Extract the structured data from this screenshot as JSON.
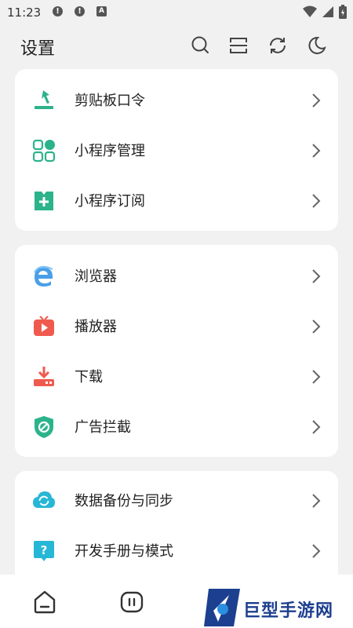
{
  "status_bar": {
    "time": "11:23",
    "alert1": "!",
    "alert2": "!",
    "alert3": "A"
  },
  "header": {
    "title": "设置"
  },
  "sections": [
    {
      "items": [
        {
          "label": "剪贴板口令",
          "icon": "clipboard-download-icon"
        },
        {
          "label": "小程序管理",
          "icon": "grid-apps-icon"
        },
        {
          "label": "小程序订阅",
          "icon": "bookmark-plus-icon"
        }
      ]
    },
    {
      "items": [
        {
          "label": "浏览器",
          "icon": "browser-e-icon"
        },
        {
          "label": "播放器",
          "icon": "tv-play-icon"
        },
        {
          "label": "下载",
          "icon": "download-icon"
        },
        {
          "label": "广告拦截",
          "icon": "shield-block-icon"
        }
      ]
    },
    {
      "items": [
        {
          "label": "数据备份与同步",
          "icon": "cloud-sync-icon"
        },
        {
          "label": "开发手册与模式",
          "icon": "help-bubble-icon"
        }
      ]
    }
  ],
  "colors": {
    "accent_green": "#2bb38b",
    "blue": "#3ea3e6",
    "red": "#f05a4e",
    "cyan": "#27b7d6"
  },
  "watermark": {
    "text": "巨型手游网"
  }
}
